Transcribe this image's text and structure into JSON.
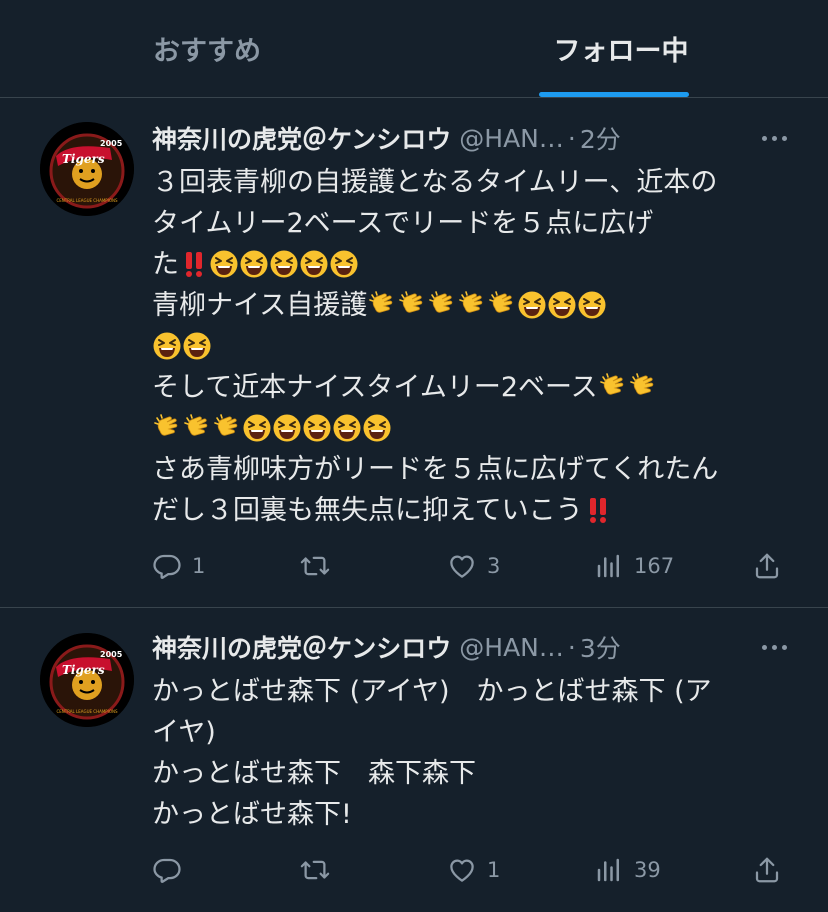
{
  "tabs": [
    {
      "label": "おすすめ",
      "active": false
    },
    {
      "label": "フォロー中",
      "active": true
    }
  ],
  "colors": {
    "background": "#15202b",
    "accent": "#1d9bf0",
    "muted": "#8b98a5",
    "text": "#e7e9ea"
  },
  "tweets": [
    {
      "name": "神奈川の虎党＠ケンシロウ",
      "handle": "@HAN…",
      "separator": "·",
      "time": "2分",
      "lines": [
        "３回表青柳の自援護となるタイムリー、近本の",
        "タイムリー2ベースでリードを５点に広げ",
        "た‼️😆😆😆😆😆",
        "青柳ナイス自援護👏👏👏👏👏😆😆😆",
        "😆😆",
        "そして近本ナイスタイムリー2ベース👏👏",
        "👏👏👏😆😆😆😆😆",
        "さあ青柳味方がリードを５点に広げてくれたん",
        "だし３回裏も無失点に抑えていこう‼️"
      ],
      "replies": "1",
      "retweets": "",
      "likes": "3",
      "views": "167"
    },
    {
      "name": "神奈川の虎党＠ケンシロウ",
      "handle": "@HAN…",
      "separator": "·",
      "time": "3分",
      "lines": [
        "かっとばせ森下 (アイヤ)　かっとばせ森下 (ア",
        "イヤ)",
        "かっとばせ森下　森下森下",
        "かっとばせ森下!"
      ],
      "replies": "",
      "retweets": "",
      "likes": "1",
      "views": "39"
    }
  ],
  "icons": {
    "avatar": "tigers-logo-avatar",
    "more": "more-icon",
    "reply": "reply-icon",
    "retweet": "retweet-icon",
    "like": "heart-icon",
    "views": "views-icon",
    "share": "share-icon",
    "double-exclamation": "double-exclamation-emoji",
    "laughing": "laughing-face-emoji",
    "clapping": "clapping-hands-emoji"
  },
  "avatar_logo": {
    "year": "2005",
    "wordmark": "Tigers",
    "ring_text": "CENTRAL LEAGUE CHAMPIONS"
  }
}
